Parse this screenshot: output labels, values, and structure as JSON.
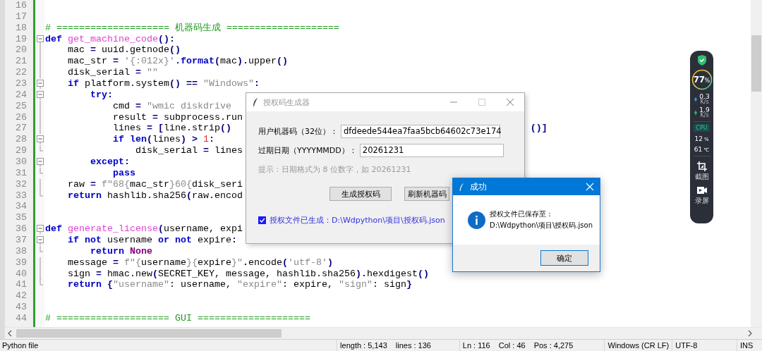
{
  "editor": {
    "lines": [
      {
        "number": "16",
        "kind": "plain"
      },
      {
        "number": "17",
        "kind": "plain"
      },
      {
        "number": "18",
        "kind": "plain",
        "tokens": [
          {
            "kind": "comment",
            "text": "# ==================== 机器码生成 ===================="
          }
        ]
      },
      {
        "number": "19",
        "kind": "fold-start",
        "tokens": [
          {
            "kind": "keyword",
            "text": "def"
          },
          {
            "kind": "function",
            "text": " get_machine_code"
          },
          {
            "kind": "operator",
            "text": "():"
          }
        ]
      },
      {
        "number": "20",
        "kind": "fold-body",
        "tokens": [
          {
            "kind": "plain",
            "text": "    mac "
          },
          {
            "kind": "operator",
            "text": "="
          },
          {
            "kind": "plain",
            "text": " uuid.getnode"
          },
          {
            "kind": "operator",
            "text": "()"
          }
        ]
      },
      {
        "number": "21",
        "kind": "fold-body",
        "tokens": [
          {
            "kind": "plain",
            "text": "    mac_str "
          },
          {
            "kind": "operator",
            "text": "="
          },
          {
            "kind": "string",
            "text": " '{:012x}'"
          },
          {
            "kind": "operator",
            "text": "."
          },
          {
            "kind": "keyword",
            "text": "format"
          },
          {
            "kind": "operator",
            "text": "("
          },
          {
            "kind": "plain",
            "text": "mac"
          },
          {
            "kind": "operator",
            "text": ")."
          },
          {
            "kind": "plain",
            "text": "upper"
          },
          {
            "kind": "operator",
            "text": "()"
          }
        ]
      },
      {
        "number": "22",
        "kind": "fold-body",
        "tokens": [
          {
            "kind": "plain",
            "text": "    disk_serial "
          },
          {
            "kind": "operator",
            "text": "="
          },
          {
            "kind": "string",
            "text": " \"\""
          }
        ]
      },
      {
        "number": "23",
        "kind": "fold-start",
        "tokens": [
          {
            "kind": "keyword",
            "text": "    if"
          },
          {
            "kind": "plain",
            "text": " platform.system"
          },
          {
            "kind": "operator",
            "text": "()"
          },
          {
            "kind": "operator",
            "text": " =="
          },
          {
            "kind": "string",
            "text": " \"Windows\""
          },
          {
            "kind": "operator",
            "text": ":"
          }
        ]
      },
      {
        "number": "24",
        "kind": "fold-start",
        "tokens": [
          {
            "kind": "keyword",
            "text": "        try"
          },
          {
            "kind": "operator",
            "text": ":"
          }
        ]
      },
      {
        "number": "25",
        "kind": "fold-body",
        "tokens": [
          {
            "kind": "plain",
            "text": "            cmd "
          },
          {
            "kind": "operator",
            "text": "="
          },
          {
            "kind": "string",
            "text": " \"wmic diskdrive"
          }
        ]
      },
      {
        "number": "26",
        "kind": "fold-body",
        "tokens": [
          {
            "kind": "plain",
            "text": "            result "
          },
          {
            "kind": "operator",
            "text": "="
          },
          {
            "kind": "plain",
            "text": " subprocess.run"
          }
        ]
      },
      {
        "number": "27",
        "kind": "fold-body",
        "tail": "()]",
        "tokens": [
          {
            "kind": "plain",
            "text": "            lines "
          },
          {
            "kind": "operator",
            "text": "="
          },
          {
            "kind": "operator",
            "text": " ["
          },
          {
            "kind": "plain",
            "text": "line.strip"
          },
          {
            "kind": "operator",
            "text": "()"
          }
        ]
      },
      {
        "number": "28",
        "kind": "fold-start",
        "tokens": [
          {
            "kind": "keyword",
            "text": "            if"
          },
          {
            "kind": "keyword",
            "text": " len"
          },
          {
            "kind": "operator",
            "text": "("
          },
          {
            "kind": "plain",
            "text": "lines"
          },
          {
            "kind": "operator",
            "text": ")"
          },
          {
            "kind": "operator",
            "text": " >"
          },
          {
            "kind": "number",
            "text": " 1"
          },
          {
            "kind": "operator",
            "text": ":"
          }
        ]
      },
      {
        "number": "29",
        "kind": "fold-end",
        "tokens": [
          {
            "kind": "plain",
            "text": "                disk_serial "
          },
          {
            "kind": "operator",
            "text": "="
          },
          {
            "kind": "plain",
            "text": " lines"
          }
        ]
      },
      {
        "number": "30",
        "kind": "fold-start",
        "tokens": [
          {
            "kind": "keyword",
            "text": "        except"
          },
          {
            "kind": "operator",
            "text": ":"
          }
        ]
      },
      {
        "number": "31",
        "kind": "fold-end",
        "tokens": [
          {
            "kind": "keyword",
            "text": "            pass"
          }
        ]
      },
      {
        "number": "32",
        "kind": "fold-body",
        "tokens": [
          {
            "kind": "plain",
            "text": "    raw "
          },
          {
            "kind": "operator",
            "text": "="
          },
          {
            "kind": "string",
            "text": " f\"68{"
          },
          {
            "kind": "plain",
            "text": "mac_str"
          },
          {
            "kind": "string",
            "text": "}60{"
          },
          {
            "kind": "plain",
            "text": "disk_seri"
          }
        ]
      },
      {
        "number": "33",
        "kind": "fold-end",
        "tokens": [
          {
            "kind": "keyword",
            "text": "    return"
          },
          {
            "kind": "plain",
            "text": " hashlib.sha256"
          },
          {
            "kind": "operator",
            "text": "("
          },
          {
            "kind": "plain",
            "text": "raw.encod"
          }
        ]
      },
      {
        "number": "34",
        "kind": "plain"
      },
      {
        "number": "35",
        "kind": "plain"
      },
      {
        "number": "36",
        "kind": "fold-start",
        "tokens": [
          {
            "kind": "keyword",
            "text": "def"
          },
          {
            "kind": "function",
            "text": " generate_license"
          },
          {
            "kind": "operator",
            "text": "("
          },
          {
            "kind": "plain",
            "text": "username, expi"
          }
        ]
      },
      {
        "number": "37",
        "kind": "fold-start",
        "tokens": [
          {
            "kind": "keyword",
            "text": "    if"
          },
          {
            "kind": "keyword",
            "text": " not"
          },
          {
            "kind": "plain",
            "text": " username "
          },
          {
            "kind": "keyword",
            "text": "or"
          },
          {
            "kind": "keyword",
            "text": " not"
          },
          {
            "kind": "plain",
            "text": " expire"
          },
          {
            "kind": "operator",
            "text": ":"
          }
        ]
      },
      {
        "number": "38",
        "kind": "fold-end",
        "tokens": [
          {
            "kind": "keyword",
            "text": "        return"
          },
          {
            "kind": "constant",
            "text": " None"
          }
        ]
      },
      {
        "number": "39",
        "kind": "fold-body",
        "tokens": [
          {
            "kind": "plain",
            "text": "    message "
          },
          {
            "kind": "operator",
            "text": "="
          },
          {
            "kind": "string",
            "text": " f\"{"
          },
          {
            "kind": "plain",
            "text": "username"
          },
          {
            "kind": "string",
            "text": "}{"
          },
          {
            "kind": "plain",
            "text": "expire"
          },
          {
            "kind": "string",
            "text": "}\""
          },
          {
            "kind": "operator",
            "text": "."
          },
          {
            "kind": "plain",
            "text": "encode"
          },
          {
            "kind": "operator",
            "text": "("
          },
          {
            "kind": "string",
            "text": "'utf-8'"
          },
          {
            "kind": "operator",
            "text": ")"
          }
        ]
      },
      {
        "number": "40",
        "kind": "fold-body",
        "tokens": [
          {
            "kind": "plain",
            "text": "    sign "
          },
          {
            "kind": "operator",
            "text": "="
          },
          {
            "kind": "plain",
            "text": " hmac.new"
          },
          {
            "kind": "operator",
            "text": "("
          },
          {
            "kind": "plain",
            "text": "SECRET_KEY, message, hashlib.sha256"
          },
          {
            "kind": "operator",
            "text": ")."
          },
          {
            "kind": "plain",
            "text": "hexdigest"
          },
          {
            "kind": "operator",
            "text": "()"
          }
        ]
      },
      {
        "number": "41",
        "kind": "fold-end",
        "tokens": [
          {
            "kind": "keyword",
            "text": "    return"
          },
          {
            "kind": "operator",
            "text": " {"
          },
          {
            "kind": "string",
            "text": "\"username\""
          },
          {
            "kind": "plain",
            "text": ": username, "
          },
          {
            "kind": "string",
            "text": "\"expire\""
          },
          {
            "kind": "plain",
            "text": ": expire, "
          },
          {
            "kind": "string",
            "text": "\"sign\""
          },
          {
            "kind": "plain",
            "text": ": sign"
          },
          {
            "kind": "operator",
            "text": "}"
          }
        ]
      },
      {
        "number": "42",
        "kind": "plain"
      },
      {
        "number": "43",
        "kind": "plain"
      },
      {
        "number": "44",
        "kind": "plain",
        "tokens": [
          {
            "kind": "comment",
            "text": "# ==================== GUI ===================="
          }
        ]
      }
    ]
  },
  "dialog": {
    "title": "授权码生成器",
    "fields": [
      {
        "label": "用户机器码（32位）：",
        "value": "dfdeede544ea7faa5bcb64602c73e174"
      },
      {
        "label": "过期日期（YYYYMMDD）：",
        "value": "20261231"
      }
    ],
    "hint": "提示：日期格式为 8 位数字，如 20261231",
    "buttons": [
      "生成授权码",
      "刷新机器码"
    ],
    "status": {
      "checked": true,
      "text": "授权文件已生成：D:\\Wdpython\\项目\\授权码.json"
    }
  },
  "message_box": {
    "title": "成功",
    "lines": [
      "授权文件已保存至：",
      "D:\\Wdpython\\项目\\授权码.json"
    ],
    "button": "确定"
  },
  "monitor_widget": {
    "memory": "77",
    "memory_unit": "%",
    "upload": "0.3",
    "upload_unit": "K/s",
    "download": "1.9",
    "download_unit": "K/s",
    "cpu_label": "CPU",
    "cpu_usage": "12",
    "cpu_usage_unit": "%",
    "cpu_temp": "61",
    "cpu_temp_unit": "℃",
    "tools": [
      "截图",
      "录屏"
    ]
  },
  "status_bar": {
    "file_type": "Python file",
    "items": [
      "length : 5,143",
      "lines : 136",
      "Ln : 116",
      "Col : 46",
      "Pos : 4,275",
      "Windows (CR LF)",
      "UTF-8",
      "INS"
    ]
  }
}
